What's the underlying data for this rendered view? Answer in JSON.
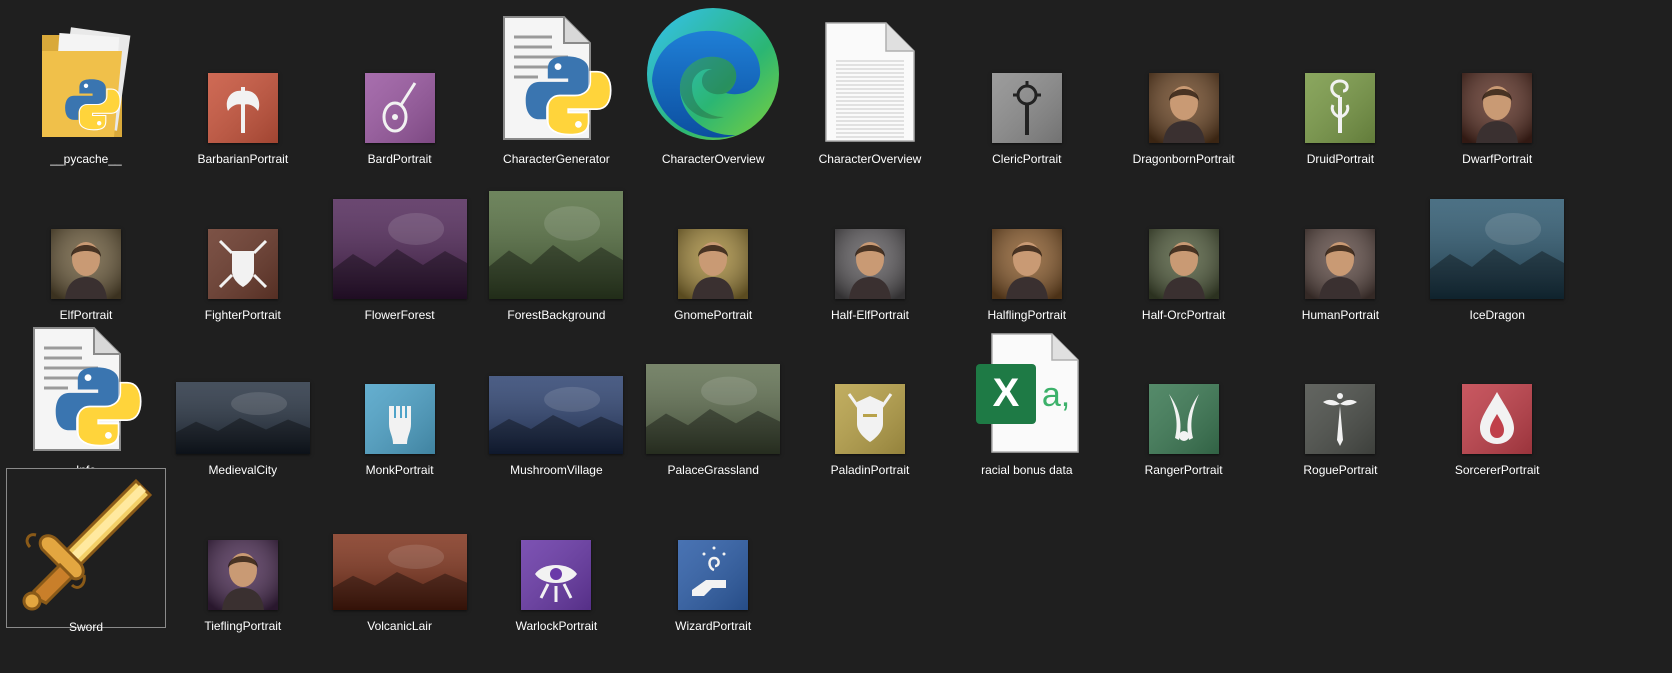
{
  "colors": {
    "background": "#1f1f1f",
    "label": "#ffffff",
    "selection_border": "#8a8a8a"
  },
  "files": [
    {
      "label": "__pycache__",
      "icon": "python-folder-icon",
      "kind": "folder"
    },
    {
      "label": "BarbarianPortrait",
      "icon": "barbarian-axe-icon",
      "kind": "portrait",
      "color": "#c8553d"
    },
    {
      "label": "BardPortrait",
      "icon": "bard-lute-icon",
      "kind": "portrait",
      "color": "#9b5aa2"
    },
    {
      "label": "CharacterGenerator",
      "icon": "python-file-icon",
      "kind": "python"
    },
    {
      "label": "CharacterOverview",
      "icon": "edge-browser-icon",
      "kind": "edge"
    },
    {
      "label": "CharacterOverview",
      "icon": "text-document-icon",
      "kind": "text"
    },
    {
      "label": "ClericPortrait",
      "icon": "cleric-mace-icon",
      "kind": "portrait",
      "color": "#8e8e8e"
    },
    {
      "label": "DragonbornPortrait",
      "icon": "dragonborn-portrait-icon",
      "kind": "portrait",
      "color": "#6b4422"
    },
    {
      "label": "DruidPortrait",
      "icon": "druid-staff-icon",
      "kind": "portrait",
      "color": "#7a9a48"
    },
    {
      "label": "DwarfPortrait",
      "icon": "dwarf-portrait-icon",
      "kind": "portrait",
      "color": "#5a2e22"
    },
    {
      "label": "ElfPortrait",
      "icon": "elf-portrait-icon",
      "kind": "portrait",
      "color": "#6b5a3a"
    },
    {
      "label": "FighterPortrait",
      "icon": "fighter-shield-icon",
      "kind": "portrait",
      "color": "#6a3a2c"
    },
    {
      "label": "FlowerForest",
      "icon": "flower-forest-image-icon",
      "kind": "landscape",
      "color": "#4a1f52"
    },
    {
      "label": "ForestBackground",
      "icon": "forest-background-image-icon",
      "kind": "landscape",
      "color": "#4f6a3a"
    },
    {
      "label": "GnomePortrait",
      "icon": "gnome-portrait-icon",
      "kind": "portrait",
      "color": "#a3883a"
    },
    {
      "label": "Half-ElfPortrait",
      "icon": "half-elf-portrait-icon",
      "kind": "portrait",
      "color": "#5d5a5d"
    },
    {
      "label": "HalflingPortrait",
      "icon": "halfling-portrait-icon",
      "kind": "portrait",
      "color": "#8a5a2a"
    },
    {
      "label": "Half-OrcPortrait",
      "icon": "half-orc-portrait-icon",
      "kind": "portrait",
      "color": "#4f5a3a"
    },
    {
      "label": "HumanPortrait",
      "icon": "human-portrait-icon",
      "kind": "portrait",
      "color": "#5e4a44"
    },
    {
      "label": "IceDragon",
      "icon": "ice-dragon-image-icon",
      "kind": "landscape",
      "color": "#25526a"
    },
    {
      "label": "Info",
      "icon": "python-file-icon",
      "kind": "python"
    },
    {
      "label": "MedievalCity",
      "icon": "medieval-city-image-icon",
      "kind": "landscape",
      "color": "#1e2a3a"
    },
    {
      "label": "MonkPortrait",
      "icon": "monk-fist-icon",
      "kind": "portrait",
      "color": "#4fa3c8"
    },
    {
      "label": "MushroomVillage",
      "icon": "mushroom-village-image-icon",
      "kind": "landscape",
      "color": "#243a6a"
    },
    {
      "label": "PalaceGrassland",
      "icon": "palace-grassland-image-icon",
      "kind": "landscape",
      "color": "#5a6a4a"
    },
    {
      "label": "PaladinPortrait",
      "icon": "paladin-helm-icon",
      "kind": "portrait",
      "color": "#b8a24a"
    },
    {
      "label": "racial bonus data",
      "icon": "excel-csv-icon",
      "kind": "excel"
    },
    {
      "label": "RangerPortrait",
      "icon": "ranger-blades-icon",
      "kind": "portrait",
      "color": "#3d7a55"
    },
    {
      "label": "RoguePortrait",
      "icon": "rogue-dagger-icon",
      "kind": "portrait",
      "color": "#4c4f4a"
    },
    {
      "label": "SorcererPortrait",
      "icon": "sorcerer-flame-icon",
      "kind": "portrait",
      "color": "#c0404a"
    },
    {
      "label": "Sword",
      "icon": "sword-icon",
      "kind": "sword",
      "selected": true
    },
    {
      "label": "TieflingPortrait",
      "icon": "tiefling-portrait-icon",
      "kind": "portrait",
      "color": "#4a2a52"
    },
    {
      "label": "VolcanicLair",
      "icon": "volcanic-lair-image-icon",
      "kind": "landscape",
      "color": "#7a2a12"
    },
    {
      "label": "WarlockPortrait",
      "icon": "warlock-eye-icon",
      "kind": "portrait",
      "color": "#6a3aa8"
    },
    {
      "label": "WizardPortrait",
      "icon": "wizard-hand-icon",
      "kind": "portrait",
      "color": "#2f5fa8"
    }
  ]
}
